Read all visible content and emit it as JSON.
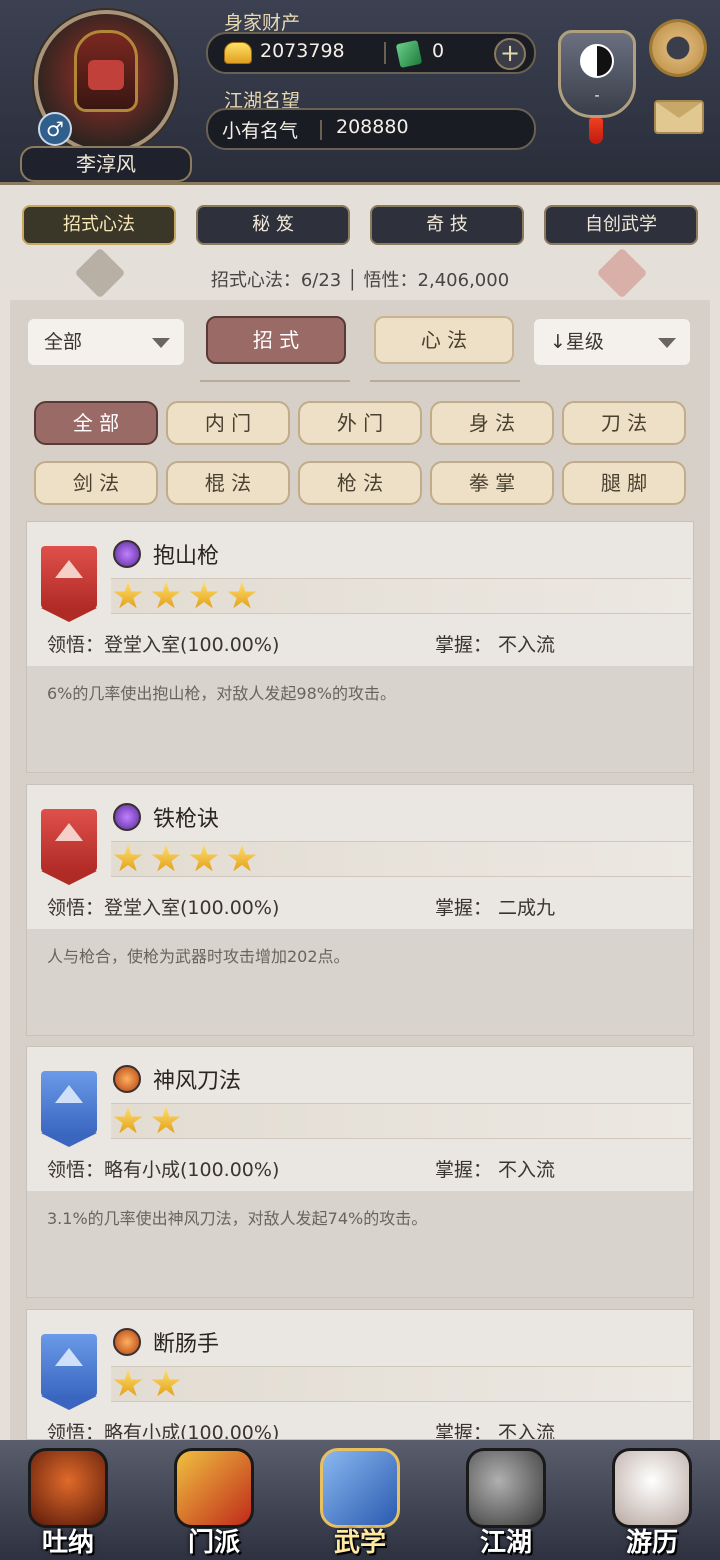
{
  "player": {
    "name": "李淳风",
    "gender_symbol": "♂",
    "wealth_label": "身家财产",
    "gold": "2073798",
    "jade": "0",
    "add_symbol": "+",
    "reputation_label": "江湖名望",
    "reputation_title": "小有名气",
    "reputation_value": "208880",
    "badge_text": "-"
  },
  "category_tabs": [
    {
      "label": "招式心法",
      "active": true
    },
    {
      "label": "秘 笈",
      "active": false
    },
    {
      "label": "奇 技",
      "active": false
    },
    {
      "label": "自创武学",
      "active": false
    }
  ],
  "stats": {
    "text": "招式心法：6/23 │ 悟性：2,406,000"
  },
  "filters": {
    "scope_dropdown": "全部",
    "mode_tabs": [
      {
        "label": "招 式",
        "active": true
      },
      {
        "label": "心 法",
        "active": false
      }
    ],
    "sort_dropdown": "↓星级",
    "type_filters_row1": [
      "全 部",
      "内 门",
      "外 门",
      "身 法",
      "刀 法"
    ],
    "type_filters_row2": [
      "剑 法",
      "棍 法",
      "枪 法",
      "拳 掌",
      "腿 脚"
    ]
  },
  "skills": [
    {
      "name": "抱山枪",
      "banner": "red",
      "icon": "purple",
      "stars": 4,
      "comprehension": "领悟：登堂入室(100.00%)",
      "mastery": "掌握：  不入流",
      "description": "6%的几率使出抱山枪，对敌人发起98%的攻击。"
    },
    {
      "name": "铁枪诀",
      "banner": "red",
      "icon": "purple",
      "stars": 4,
      "comprehension": "领悟：登堂入室(100.00%)",
      "mastery": "掌握：  二成九",
      "description": "人与枪合，使枪为武器时攻击增加202点。"
    },
    {
      "name": "神风刀法",
      "banner": "blue",
      "icon": "orange",
      "stars": 2,
      "comprehension": "领悟：略有小成(100.00%)",
      "mastery": "掌握：  不入流",
      "description": "3.1%的几率使出神风刀法，对敌人发起74%的攻击。"
    },
    {
      "name": "断肠手",
      "banner": "blue",
      "icon": "orange",
      "stars": 2,
      "comprehension": "领悟：略有小成(100.00%)",
      "mastery": "掌握：  不入流",
      "description": ""
    }
  ],
  "nav": [
    {
      "label": "吐纳",
      "icon": "monk-icon",
      "color": "#c24a1a",
      "active": false
    },
    {
      "label": "门派",
      "icon": "sect-flag-icon",
      "color": "#e0a020",
      "active": false
    },
    {
      "label": "武学",
      "icon": "martial-book-icon",
      "color": "#4a7ac8",
      "active": true
    },
    {
      "label": "江湖",
      "icon": "bamboo-hat-icon",
      "color": "#8a8a8a",
      "active": false
    },
    {
      "label": "游历",
      "icon": "horse-icon",
      "color": "#e8e0d8",
      "active": false
    }
  ]
}
